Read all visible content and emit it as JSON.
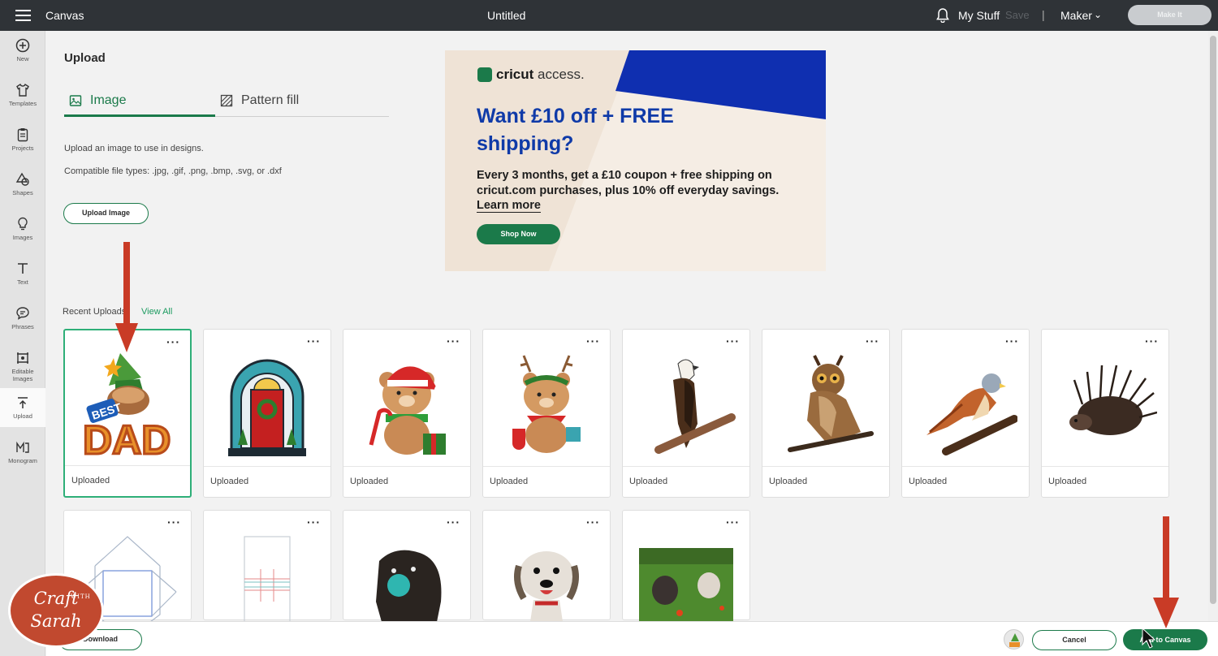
{
  "topbar": {
    "app_name": "Canvas",
    "doc_title": "Untitled",
    "my_stuff": "My Stuff",
    "save": "Save",
    "separator": "|",
    "machine": "Maker",
    "make_it": "Make It"
  },
  "nav": {
    "items": [
      {
        "label": "New",
        "icon": "plus-circle-icon"
      },
      {
        "label": "Templates",
        "icon": "shirt-icon"
      },
      {
        "label": "Projects",
        "icon": "clipboard-icon"
      },
      {
        "label": "Shapes",
        "icon": "shapes-icon"
      },
      {
        "label": "Images",
        "icon": "lightbulb-icon"
      },
      {
        "label": "Text",
        "icon": "text-icon"
      },
      {
        "label": "Phrases",
        "icon": "speech-bubble-icon"
      },
      {
        "label": "Editable Images",
        "icon": "editable-images-icon"
      },
      {
        "label": "Upload",
        "icon": "upload-icon"
      },
      {
        "label": "Monogram",
        "icon": "monogram-icon"
      }
    ],
    "active": "Upload"
  },
  "upload": {
    "heading": "Upload",
    "tabs": [
      {
        "label": "Image",
        "icon": "image-icon"
      },
      {
        "label": "Pattern fill",
        "icon": "pattern-icon"
      }
    ],
    "active_tab": "Image",
    "description": "Upload an image to use in designs.",
    "file_types": "Compatible file types: .jpg, .gif, .png, .bmp, .svg, or .dxf",
    "upload_button": "Upload Image"
  },
  "ad": {
    "brand": "cricut",
    "brand_suffix": "access.",
    "headline": "Want £10 off + FREE shipping?",
    "body": "Every 3 months, get a £10 coupon + free shipping on cricut.com purchases, plus 10% off everyday savings.",
    "learn_more": "Learn more",
    "cta": "Shop Now",
    "colors": {
      "blue": "#0f3aa8",
      "green": "#1b7a4a",
      "beige": "#efe3d6"
    }
  },
  "recent": {
    "label": "Recent Uploads",
    "view_all": "View All",
    "items": [
      {
        "name": "best-dad-gnome",
        "caption": "Uploaded",
        "selected": true
      },
      {
        "name": "christmas-door-arch",
        "caption": "Uploaded"
      },
      {
        "name": "santa-bear",
        "caption": "Uploaded"
      },
      {
        "name": "reindeer-bear",
        "caption": "Uploaded"
      },
      {
        "name": "eagle",
        "caption": "Uploaded"
      },
      {
        "name": "owl",
        "caption": "Uploaded"
      },
      {
        "name": "kestrel",
        "caption": "Uploaded"
      },
      {
        "name": "porcupine",
        "caption": "Uploaded"
      },
      {
        "name": "envelope-template",
        "caption": ""
      },
      {
        "name": "box-template",
        "caption": ""
      },
      {
        "name": "dog-with-ball",
        "caption": ""
      },
      {
        "name": "dog-running",
        "caption": ""
      },
      {
        "name": "dogs-on-grass-photo",
        "caption": ""
      }
    ]
  },
  "bottom": {
    "download": "Download",
    "cancel": "Cancel",
    "add_to_canvas": "Add to Canvas"
  },
  "watermark": {
    "line1": "Craft",
    "with": "WITH",
    "line2": "Sarah"
  }
}
